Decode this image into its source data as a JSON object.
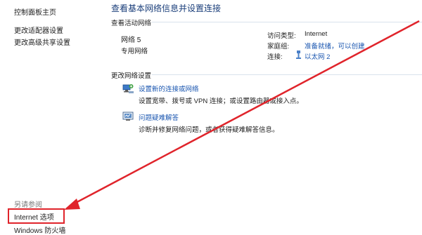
{
  "sidebar": {
    "home": "控制面板主页",
    "items": [
      {
        "label": "更改适配器设置"
      },
      {
        "label": "更改高级共享设置"
      }
    ],
    "see_also_label": "另请参阅",
    "see_also": [
      {
        "label": "Internet 选项"
      },
      {
        "label": "Windows 防火墙"
      }
    ]
  },
  "main": {
    "title": "查看基本网络信息并设置连接",
    "active_networks_label": "查看活动网络",
    "network": {
      "name": "网络 5",
      "type": "专用网络",
      "access_type_label": "访问类型:",
      "access_type_value": "Internet",
      "homegroup_label": "家庭组:",
      "homegroup_value": "准备就绪，可以创建",
      "connections_label": "连接:",
      "connections_value": "以太网 2"
    },
    "change_settings_label": "更改网络设置",
    "tasks": [
      {
        "title": "设置新的连接或网络",
        "desc": "设置宽带、拨号或 VPN 连接；或设置路由器或接入点。",
        "icon": "network-setup-icon"
      },
      {
        "title": "问题疑难解答",
        "desc": "诊断并修复网络问题，或者获得疑难解答信息。",
        "icon": "troubleshoot-icon"
      }
    ]
  },
  "colors": {
    "link": "#1a56b0",
    "annotation_red": "#e0242b"
  }
}
